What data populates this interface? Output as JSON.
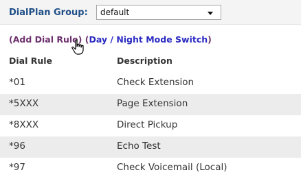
{
  "dialplan": {
    "group_label": "DialPlan Group:",
    "group_selected": "default"
  },
  "actions": {
    "add_rule": "Add Dial Rule",
    "day_night": "Day / Night Mode Switch"
  },
  "table": {
    "headers": [
      "Dial Rule",
      "Description"
    ],
    "rows": [
      {
        "rule": "*01",
        "description": "Check Extension"
      },
      {
        "rule": "*5XXX",
        "description": "Page Extension"
      },
      {
        "rule": "*8XXX",
        "description": "Direct Pickup"
      },
      {
        "rule": "*96",
        "description": "Echo Test"
      },
      {
        "rule": "*97",
        "description": "Check Voicemail (Local)"
      }
    ]
  }
}
